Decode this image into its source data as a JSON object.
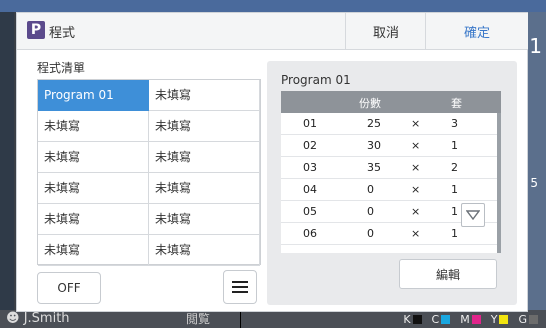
{
  "background": {
    "user": "J.Smith",
    "status_text": "閲覧",
    "right_glyph_top": "1",
    "right_glyph_mid": "5",
    "cmyk": [
      {
        "label": "K",
        "color": "#111111"
      },
      {
        "label": "C",
        "color": "#19a7e0"
      },
      {
        "label": "M",
        "color": "#e0258b"
      },
      {
        "label": "Y",
        "color": "#f1e40f"
      },
      {
        "label": "G",
        "color": "#6c6c6c"
      }
    ]
  },
  "dialog": {
    "icon_letter": "P",
    "title": "程式",
    "cancel_label": "取消",
    "confirm_label": "確定"
  },
  "program_list": {
    "label": "程式清單",
    "items": [
      [
        "Program 01",
        "未填寫"
      ],
      [
        "未填寫",
        "未填寫"
      ],
      [
        "未填寫",
        "未填寫"
      ],
      [
        "未填寫",
        "未填寫"
      ],
      [
        "未填寫",
        "未填寫"
      ],
      [
        "未填寫",
        "未填寫"
      ]
    ],
    "selected": "Program 01"
  },
  "off_label": "OFF",
  "detail": {
    "title": "Program 01",
    "col_copies": "份數",
    "col_sets": "套",
    "rows": [
      {
        "no": "01",
        "copies": "25",
        "x": "×",
        "sets": "3"
      },
      {
        "no": "02",
        "copies": "30",
        "x": "×",
        "sets": "1"
      },
      {
        "no": "03",
        "copies": "35",
        "x": "×",
        "sets": "2"
      },
      {
        "no": "04",
        "copies": "0",
        "x": "×",
        "sets": "1"
      },
      {
        "no": "05",
        "copies": "0",
        "x": "×",
        "sets": "1"
      },
      {
        "no": "06",
        "copies": "0",
        "x": "×",
        "sets": "1"
      }
    ],
    "edit_label": "編輯"
  }
}
